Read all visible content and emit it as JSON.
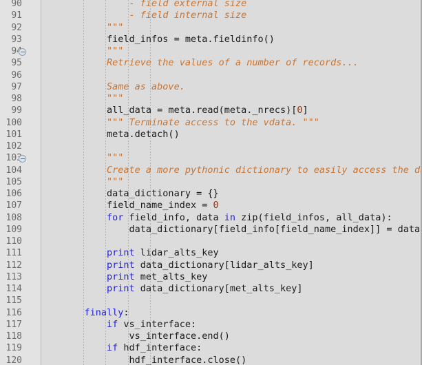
{
  "editor": {
    "language": "Python",
    "first_visible_line": 90,
    "last_visible_line": 120,
    "colors": {
      "background": "#dcdcdc",
      "gutter_background": "#e3e3e3",
      "line_number": "#6b6b6b",
      "text": "#202020",
      "keyword": "#2222dd",
      "comment": "#c87533",
      "number": "#a03000"
    },
    "fold_markers": [
      94,
      103
    ],
    "fold_marker_icon": "collapse-circle-minus-icon",
    "indent_guide_columns": [
      1,
      2,
      3,
      4
    ]
  },
  "lines": [
    {
      "n": 90,
      "indent": 12,
      "tokens": [
        {
          "t": "- field external size",
          "c": "cmt"
        }
      ]
    },
    {
      "n": 91,
      "indent": 12,
      "tokens": [
        {
          "t": "- field internal size",
          "c": "cmt"
        }
      ]
    },
    {
      "n": 92,
      "indent": 8,
      "tokens": [
        {
          "t": "\"\"\"",
          "c": "cmt"
        }
      ]
    },
    {
      "n": 93,
      "indent": 8,
      "tokens": [
        {
          "t": "field_infos = meta.fieldinfo()",
          "c": "plain"
        }
      ]
    },
    {
      "n": 94,
      "indent": 8,
      "tokens": [
        {
          "t": "\"\"\"",
          "c": "cmt"
        }
      ]
    },
    {
      "n": 95,
      "indent": 8,
      "tokens": [
        {
          "t": "Retrieve the values of a number of records...",
          "c": "cmt"
        }
      ]
    },
    {
      "n": 96,
      "indent": 0,
      "tokens": []
    },
    {
      "n": 97,
      "indent": 8,
      "tokens": [
        {
          "t": "Same as above.",
          "c": "cmt"
        }
      ]
    },
    {
      "n": 98,
      "indent": 8,
      "tokens": [
        {
          "t": "\"\"\"",
          "c": "cmt"
        }
      ]
    },
    {
      "n": 99,
      "indent": 8,
      "tokens": [
        {
          "t": "all_data = meta.read(meta._nrecs)[",
          "c": "plain"
        },
        {
          "t": "0",
          "c": "num"
        },
        {
          "t": "]",
          "c": "plain"
        }
      ]
    },
    {
      "n": 100,
      "indent": 8,
      "tokens": [
        {
          "t": "\"\"\" Terminate access to the vdata. \"\"\"",
          "c": "cmt"
        }
      ]
    },
    {
      "n": 101,
      "indent": 8,
      "tokens": [
        {
          "t": "meta.detach()",
          "c": "plain"
        }
      ]
    },
    {
      "n": 102,
      "indent": 0,
      "tokens": []
    },
    {
      "n": 103,
      "indent": 8,
      "tokens": [
        {
          "t": "\"\"\"",
          "c": "cmt"
        }
      ]
    },
    {
      "n": 104,
      "indent": 8,
      "tokens": [
        {
          "t": "Create a more pythonic dictionary to easily access the data.",
          "c": "cmt"
        }
      ]
    },
    {
      "n": 105,
      "indent": 8,
      "tokens": [
        {
          "t": "\"\"\"",
          "c": "cmt"
        }
      ]
    },
    {
      "n": 106,
      "indent": 8,
      "tokens": [
        {
          "t": "data_dictionary = {}",
          "c": "plain"
        }
      ]
    },
    {
      "n": 107,
      "indent": 8,
      "tokens": [
        {
          "t": "field_name_index = ",
          "c": "plain"
        },
        {
          "t": "0",
          "c": "num"
        }
      ]
    },
    {
      "n": 108,
      "indent": 8,
      "tokens": [
        {
          "t": "for",
          "c": "kw"
        },
        {
          "t": " field_info, data ",
          "c": "plain"
        },
        {
          "t": "in",
          "c": "kw"
        },
        {
          "t": " zip(field_infos, all_data):",
          "c": "plain"
        }
      ]
    },
    {
      "n": 109,
      "indent": 12,
      "tokens": [
        {
          "t": "data_dictionary[field_info[field_name_index]] = data",
          "c": "plain"
        }
      ]
    },
    {
      "n": 110,
      "indent": 0,
      "tokens": []
    },
    {
      "n": 111,
      "indent": 8,
      "tokens": [
        {
          "t": "print",
          "c": "kw"
        },
        {
          "t": " lidar_alts_key",
          "c": "plain"
        }
      ]
    },
    {
      "n": 112,
      "indent": 8,
      "tokens": [
        {
          "t": "print",
          "c": "kw"
        },
        {
          "t": " data_dictionary[lidar_alts_key]",
          "c": "plain"
        }
      ]
    },
    {
      "n": 113,
      "indent": 8,
      "tokens": [
        {
          "t": "print",
          "c": "kw"
        },
        {
          "t": " met_alts_key",
          "c": "plain"
        }
      ]
    },
    {
      "n": 114,
      "indent": 8,
      "tokens": [
        {
          "t": "print",
          "c": "kw"
        },
        {
          "t": " data_dictionary[met_alts_key]",
          "c": "plain"
        }
      ]
    },
    {
      "n": 115,
      "indent": 0,
      "tokens": []
    },
    {
      "n": 116,
      "indent": 4,
      "tokens": [
        {
          "t": "finally",
          "c": "kw"
        },
        {
          "t": ":",
          "c": "plain"
        }
      ]
    },
    {
      "n": 117,
      "indent": 8,
      "tokens": [
        {
          "t": "if",
          "c": "kw"
        },
        {
          "t": " vs_interface:",
          "c": "plain"
        }
      ]
    },
    {
      "n": 118,
      "indent": 12,
      "tokens": [
        {
          "t": "vs_interface.end()",
          "c": "plain"
        }
      ]
    },
    {
      "n": 119,
      "indent": 8,
      "tokens": [
        {
          "t": "if",
          "c": "kw"
        },
        {
          "t": " hdf_interface:",
          "c": "plain"
        }
      ]
    },
    {
      "n": 120,
      "indent": 12,
      "tokens": [
        {
          "t": "hdf_interface.close()",
          "c": "plain"
        }
      ]
    }
  ]
}
